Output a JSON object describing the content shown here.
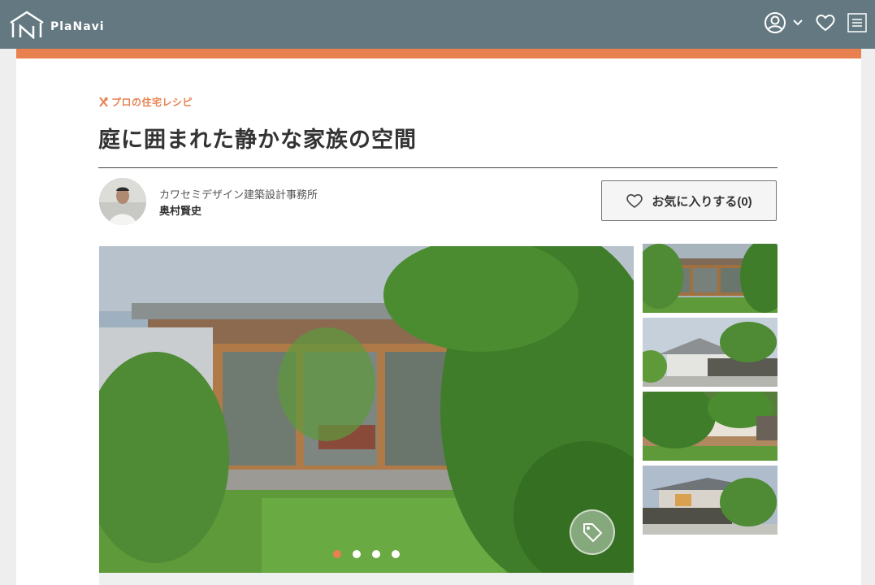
{
  "header": {
    "logo_text": "PlaNavi",
    "bg_color": "#637880",
    "icons": [
      "account-icon",
      "chevron-down-icon",
      "heart-icon",
      "menu-icon"
    ]
  },
  "accent_color": "#e8804f",
  "article": {
    "category": "プロの住宅レシピ",
    "title": "庭に囲まれた静かな家族の空間",
    "company": "カワセミデザイン建築設計事務所",
    "author": "奥村賢史",
    "favorite_label": "お気に入りする(0)"
  },
  "gallery": {
    "slide_count": 4,
    "active_slide": 1,
    "thumbnail_count": 4
  }
}
